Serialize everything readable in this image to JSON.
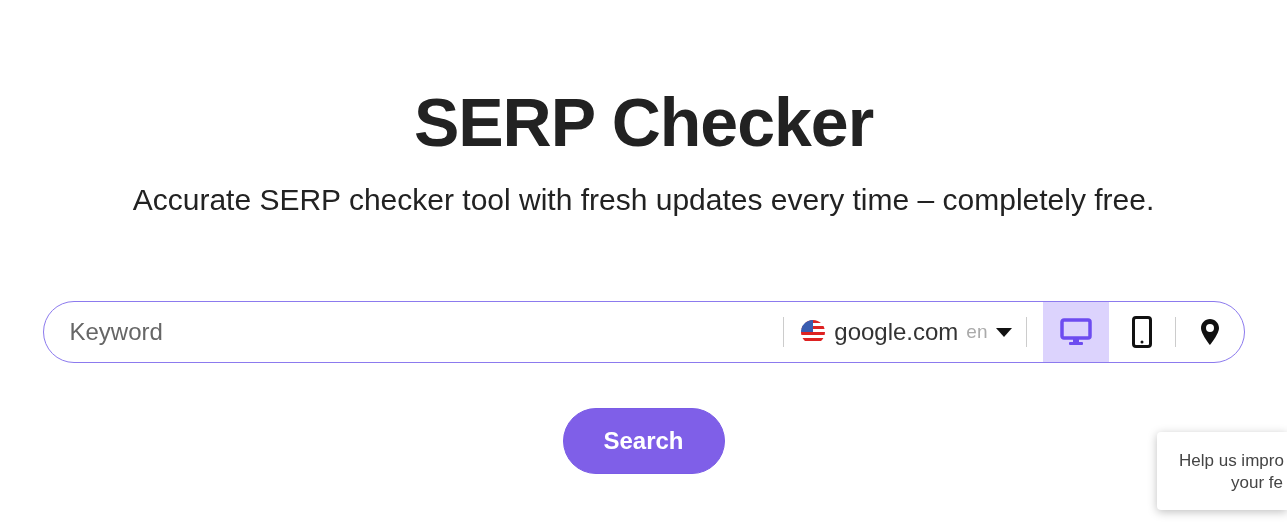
{
  "title": "SERP Checker",
  "subtitle": "Accurate SERP checker tool with fresh updates every time – completely free.",
  "search_bar": {
    "placeholder": "Keyword",
    "engine": "google.com",
    "language": "en",
    "devices": [
      {
        "kind": "desktop",
        "selected": true
      },
      {
        "kind": "mobile",
        "selected": false
      }
    ]
  },
  "search_button": "Search",
  "feedback": [
    "Help us impro",
    "your fe"
  ]
}
